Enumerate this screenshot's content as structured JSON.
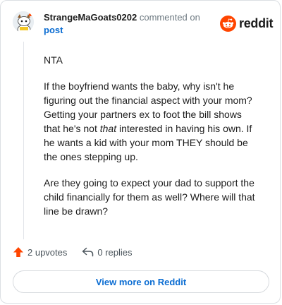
{
  "comment": {
    "username": "StrangeMaGoats0202",
    "action_text": "commented on",
    "post_link": "post"
  },
  "brand": {
    "wordmark": "reddit",
    "logo_icon": "reddit-snoo-icon",
    "color": "#ff4500"
  },
  "body": {
    "p1": "NTA",
    "p2_before": "If the boyfriend wants the baby, why isn't he figuring out the financial aspect with your mom? Getting your partners ex to foot the bill shows that he's not ",
    "p2_em": "that",
    "p2_after": " interested in having his own. If he wants a kid with your mom THEY should be the ones stepping up.",
    "p3": "Are they going to expect your dad to support the child financially for them as well? Where will that line be drawn?"
  },
  "actions": {
    "upvotes": "2 upvotes",
    "upvote_icon": "upvote-arrow-icon",
    "upvote_color": "#ff4500",
    "replies": "0 replies",
    "reply_icon": "reply-arrow-icon"
  },
  "view_more_label": "View more on Reddit",
  "link_color": "#0a6cd2"
}
